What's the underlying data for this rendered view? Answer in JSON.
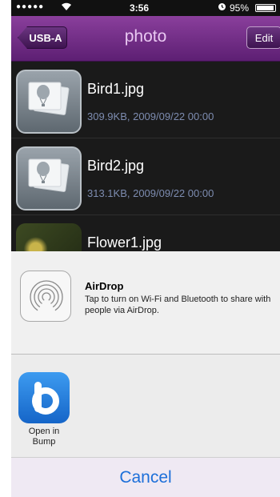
{
  "status_bar": {
    "signal": "●●●●●",
    "wifi_icon": "wifi-icon",
    "time": "3:56",
    "alarm_icon": "alarm-icon",
    "battery_text": "95%",
    "battery_level": 0.95
  },
  "nav": {
    "back_label": "USB-A",
    "title": "photo",
    "edit_label": "Edit"
  },
  "files": [
    {
      "name": "Bird1.jpg",
      "meta": "309.9KB, 2009/09/22 00:00",
      "thumb_icon": "photo-placeholder-icon"
    },
    {
      "name": "Bird2.jpg",
      "meta": "313.1KB, 2009/09/22 00:00",
      "thumb_icon": "photo-placeholder-icon"
    },
    {
      "name": "Flower1.jpg",
      "meta": "",
      "thumb_icon": "flower-thumbnail"
    }
  ],
  "share_sheet": {
    "airdrop": {
      "icon": "airdrop-icon",
      "title": "AirDrop",
      "description": "Tap to turn on Wi-Fi and Bluetooth to share with people via AirDrop."
    },
    "apps": [
      {
        "icon": "bump-icon",
        "label": "Open in Bump"
      }
    ],
    "cancel_label": "Cancel"
  },
  "colors": {
    "nav_bar": "#6e2a85",
    "meta_text": "#7d8cb0",
    "cancel_text": "#1c6fd9",
    "bump_blue": "#2479dd"
  }
}
